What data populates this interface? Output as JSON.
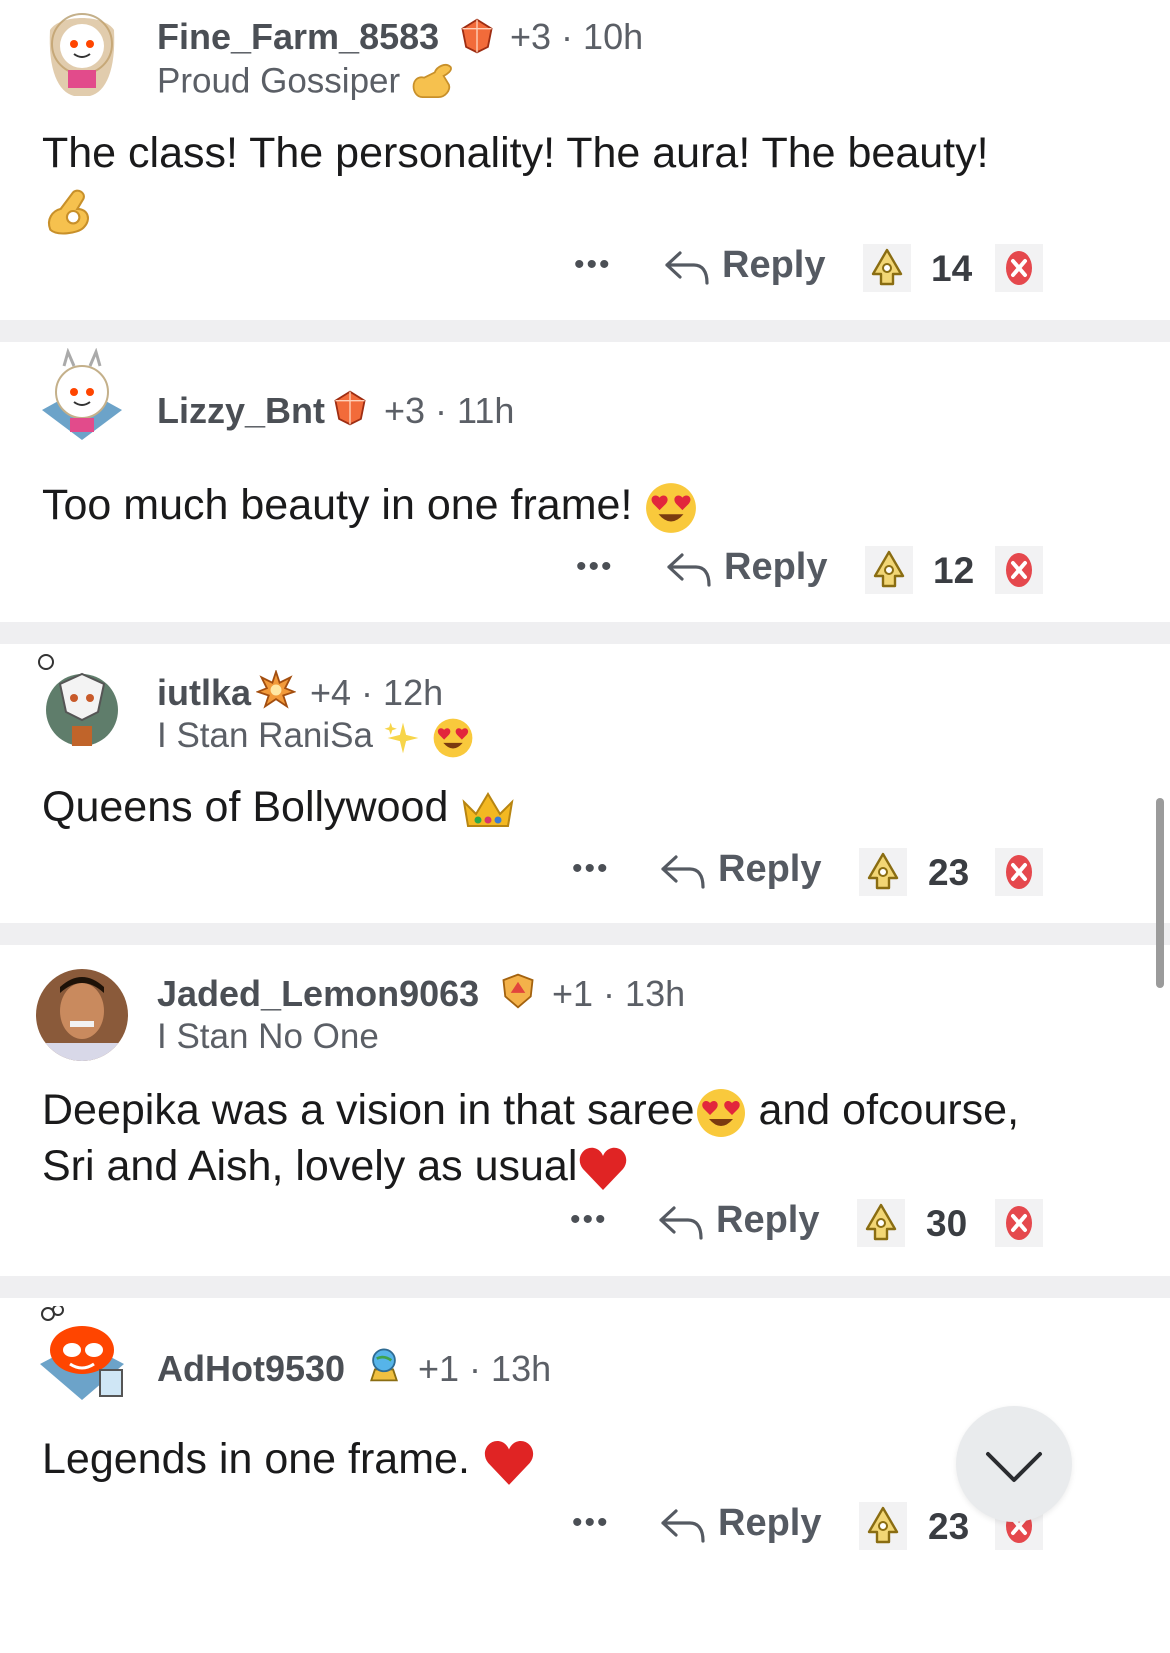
{
  "comments": [
    {
      "username": "Fine_Farm_8583",
      "achievements": "+3",
      "time": "10h",
      "flair": "Proud Gossiper",
      "flair_emoji": "call-me-hand",
      "body_line1": "The class! The personality! The aura! The beauty!",
      "body_emoji": "ok-hand",
      "reply_label": "Reply",
      "score": "14"
    },
    {
      "username": "Lizzy_Bnt",
      "achievements": "+3",
      "time": "11h",
      "body_line1": "Too much beauty in one frame!",
      "body_emoji": "heart-eyes",
      "reply_label": "Reply",
      "score": "12"
    },
    {
      "username": "iutlka",
      "achievements": "+4",
      "time": "12h",
      "flair": "I Stan RaniSa",
      "flair_emoji": "sparkles-heart-eyes",
      "body_line1": "Queens of Bollywood",
      "body_emoji": "crown",
      "reply_label": "Reply",
      "score": "23"
    },
    {
      "username": "Jaded_Lemon9063",
      "achievements": "+1",
      "time": "13h",
      "flair": "I Stan No One",
      "body_line1_a": "Deepika was a vision in that saree",
      "body_line1_b": " and ofcourse,",
      "body_line2": "Sri and Aish, lovely as usual",
      "body_emoji": "heart-eyes",
      "body_emoji2": "red-heart",
      "reply_label": "Reply",
      "score": "30"
    },
    {
      "username": "AdHot9530",
      "achievements": "+1",
      "time": "13h",
      "body_line1": "Legends in one frame.",
      "body_emoji": "red-heart",
      "reply_label": "Reply",
      "score": "23"
    }
  ],
  "dots_label": "•••",
  "colors": {
    "separator": "#efeff1",
    "username": "#4b4f55",
    "meta": "#5b5f66",
    "text": "#1a1a1b",
    "downvote": "#e5484d",
    "award": "#f0c040"
  }
}
